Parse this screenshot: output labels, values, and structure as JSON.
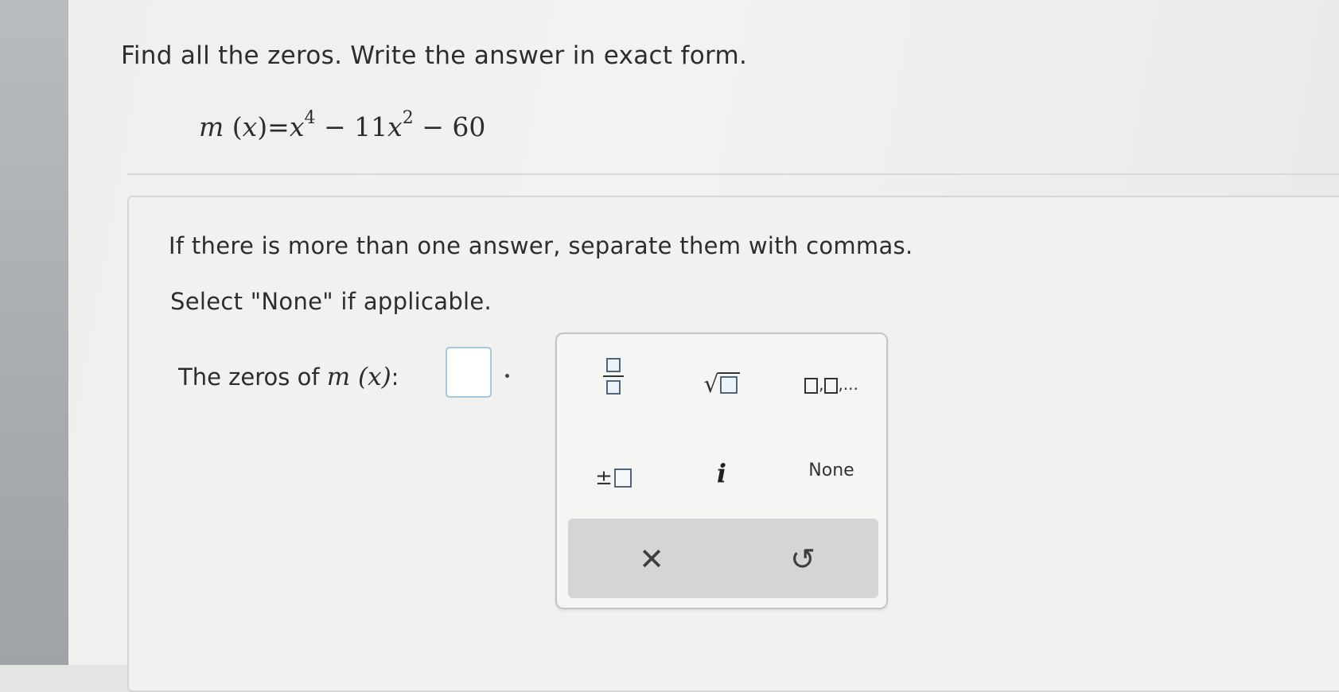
{
  "question": {
    "prompt": "Find all the zeros. Write the answer in exact form.",
    "equation": {
      "fn": "m",
      "arg": "x",
      "lhs_close": ")",
      "equals": "=",
      "term1_base": "x",
      "term1_exp": "4",
      "minus1": " − 11",
      "term2_base": "x",
      "term2_exp": "2",
      "tail": " − 60"
    }
  },
  "answer": {
    "instruction_1": "If there is more than one answer, separate them with commas.",
    "instruction_2": "Select \"None\" if applicable.",
    "label_prefix": "The zeros of ",
    "label_fn": "m (x)",
    "label_colon": ":",
    "value": ""
  },
  "palette": {
    "list_suffix": ",...",
    "plus_minus": "±",
    "imaginary": "i",
    "none_label": "None",
    "clear_symbol": "✕",
    "undo_symbol": "↺"
  }
}
